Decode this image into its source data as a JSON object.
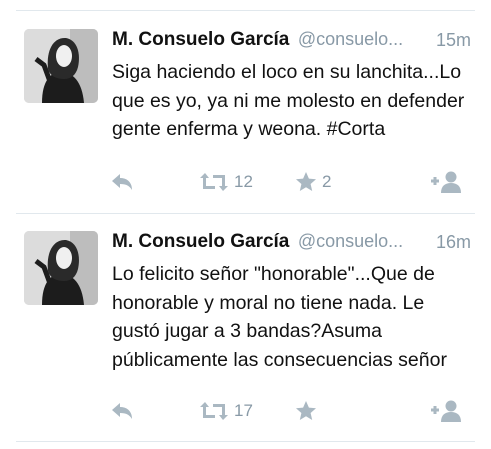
{
  "tweets": [
    {
      "name": "M. Consuelo García",
      "handle": "@consuelo...",
      "time": "15m",
      "text": "Siga haciendo el loco en su lanchita...Lo que es yo, ya ni me molesto en defender gente enferma y weona. #Corta",
      "reply_icon": "reply-icon",
      "retweet_icon": "retweet-icon",
      "retweet_count": "12",
      "favorite_icon": "star-icon",
      "favorite_count": "2",
      "follow_icon": "follow-icon"
    },
    {
      "name": "M. Consuelo García",
      "handle": "@consuelo...",
      "time": "16m",
      "text": "Lo felicito señor \"honorable\"...Que de honorable y moral no tiene nada. Le gustó jugar a 3 bandas?Asuma públicamente las consecuencias señor",
      "reply_icon": "reply-icon",
      "retweet_icon": "retweet-icon",
      "retweet_count": "17",
      "favorite_icon": "star-icon",
      "favorite_count": "",
      "follow_icon": "follow-icon"
    }
  ],
  "colors": {
    "icon_gray": "#aab8c2",
    "meta_gray": "#8899a6",
    "text": "#111111",
    "divider": "#e1e8ed"
  }
}
